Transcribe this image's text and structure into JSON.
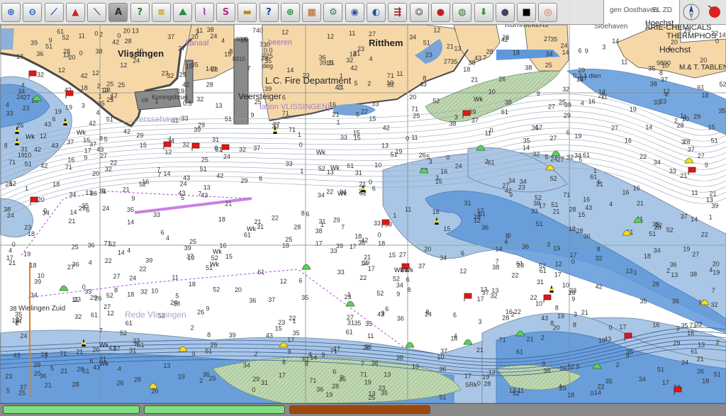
{
  "toolbar": {
    "tools": [
      {
        "name": "zoom-in-icon",
        "glyph": "⊕",
        "color": "#1f5fbf"
      },
      {
        "name": "zoom-out-icon",
        "glyph": "⊖",
        "color": "#1f5fbf"
      },
      {
        "name": "route-icon",
        "glyph": "⟋",
        "color": "#1b4fd0"
      },
      {
        "name": "ship-icon",
        "glyph": "▲",
        "color": "#d32020"
      },
      {
        "name": "measure-icon",
        "glyph": "⟍",
        "color": "#555555"
      },
      {
        "name": "text-icon",
        "glyph": "A",
        "color": "#2a2a2a"
      },
      {
        "name": "help-cursor-icon",
        "glyph": "?",
        "color": "#2a7a2a"
      },
      {
        "name": "layers-icon",
        "glyph": "≡",
        "color": "#c49000"
      },
      {
        "name": "tide-icon",
        "glyph": "⛰",
        "color": "#2a8a4a"
      },
      {
        "name": "graph-icon",
        "glyph": "⌇",
        "color": "#7a2a9a"
      },
      {
        "name": "track-icon",
        "glyph": "S",
        "color": "#c02a7a"
      },
      {
        "name": "brightness-icon",
        "glyph": "▬",
        "color": "#c08a10"
      },
      {
        "name": "info-icon",
        "glyph": "?",
        "color": "#1a3fa0"
      },
      {
        "name": "crosshair-icon",
        "glyph": "⊕",
        "color": "#2a8a2a"
      },
      {
        "name": "chart-catalog-icon",
        "glyph": "▦",
        "color": "#c05a10"
      },
      {
        "name": "settings-icon",
        "glyph": "⚙",
        "color": "#2a7a6a"
      },
      {
        "name": "ais-icon",
        "glyph": "◉",
        "color": "#2a5aa0"
      },
      {
        "name": "globe-icon",
        "glyph": "◐",
        "color": "#1a5aa0"
      },
      {
        "name": "currents-icon",
        "glyph": "⇶",
        "color": "#a02020"
      },
      {
        "name": "radio-icon",
        "glyph": "⏣",
        "color": "#444444"
      },
      {
        "name": "weather-icon",
        "glyph": "●",
        "color": "#c02020"
      },
      {
        "name": "world-icon",
        "glyph": "◍",
        "color": "#2a7a2a"
      },
      {
        "name": "download-icon",
        "glyph": "⬇",
        "color": "#2a9a2a"
      },
      {
        "name": "night-mode-icon",
        "glyph": "●",
        "color": "#444466"
      },
      {
        "name": "color-scheme-icon",
        "glyph": "■",
        "color": "#000000"
      },
      {
        "name": "lifebuoy-icon",
        "glyph": "◎",
        "color": "#e06020"
      }
    ],
    "active_index": 5
  },
  "compass": {
    "north_icon": "compass-north-icon",
    "record_icon": "record-icon"
  },
  "colors": {
    "land": "#f6d8a8",
    "deep_water": "#ffffff",
    "shallow_water": "#a9c6e6",
    "very_shallow": "#5f98da",
    "drying_flat": "#c5dcb0",
    "contour": "#6a7f9a",
    "light_buoy_red": "#e01818",
    "light_buoy_green": "#5bd25b",
    "light_buoy_yellow": "#f0e020",
    "magenta": "#b04ad8"
  },
  "labels": {
    "vlissingen": "Vlissingen",
    "ritthem": "Ritthem",
    "fire_dept": "L.C. Fire Department",
    "veerst": "Veersteiger",
    "koningsbrug": "Koningsbrug",
    "clr": "clr",
    "kanaal": "kanaal",
    "hoechst": "Hoechst",
    "hoechst_top": "Hoechst",
    "chemicals": "ARIE-CHEMICALS",
    "thermphos": "THERMPHOS",
    "mt_tablen": "M.& T. TABLEN",
    "kommekens": "Kommekens",
    "rede": "Rede Vlissingen",
    "wielingen": "Wielingen Zuid",
    "heeren": "heeren",
    "dlid": "0 2 1 dlen",
    "vlissingen_rail": "tation VLISSINGEN]",
    "sloehaven": "Sloehaven",
    "ojenhaven": "gen Oosthaven",
    "elzd": "EL ZD",
    "n9890": "9890",
    "n740": "740",
    "n730": "730",
    "n725": "725",
    "deg": "deg",
    "wk": "Wk",
    "srk": "SRk",
    "n3080": "3080",
    "d00": "0.0",
    "d05": "0.5",
    "d140": "140",
    "d8310": "8310",
    "dlinbank": "erssehaven"
  },
  "soundings": [
    "13",
    "14",
    "15",
    "16",
    "17",
    "18",
    "19",
    "11",
    "12",
    "10",
    "21",
    "22",
    "23",
    "24",
    "25",
    "27",
    "31",
    "34",
    "35",
    "37",
    "38",
    "42",
    "43",
    "51",
    "52",
    "61",
    "71",
    "4",
    "5",
    "6",
    "7",
    "8",
    "9",
    "2",
    "3",
    "1",
    "0",
    "20",
    "26",
    "28",
    "29",
    "32",
    "33",
    "36",
    "39"
  ]
}
